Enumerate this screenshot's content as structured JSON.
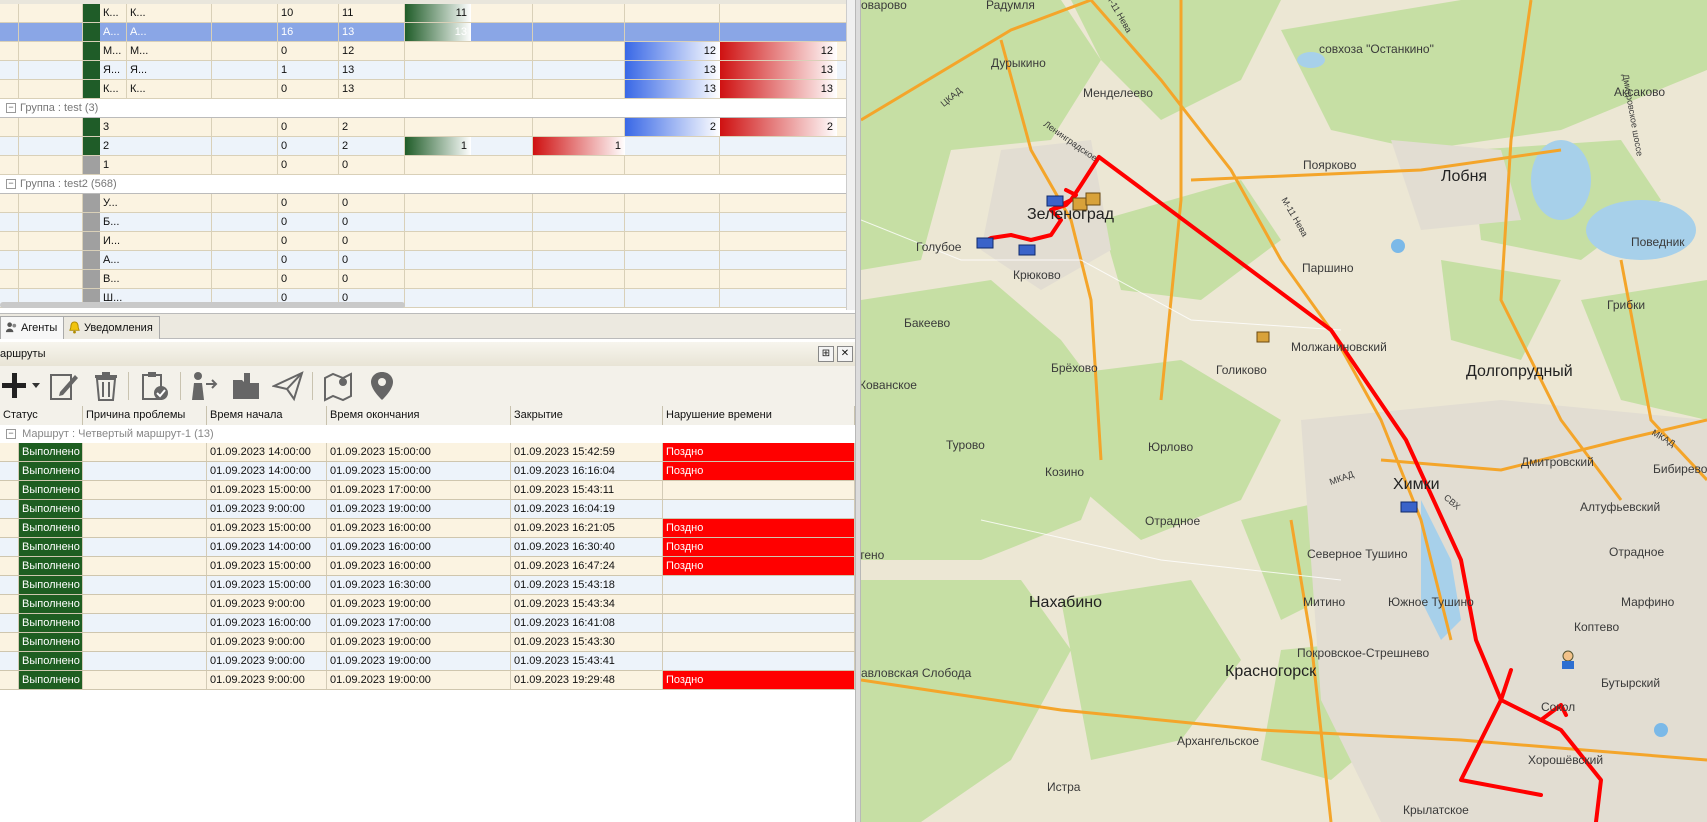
{
  "agents": {
    "rows": [
      {
        "name": "К...",
        "name2": "К...",
        "v1": "10",
        "v2": "11",
        "bar_green": "11",
        "swatch": "#1f5c28",
        "state": "even"
      },
      {
        "name": "А...",
        "name2": "А...",
        "v1": "16",
        "v2": "13",
        "bar_green": "13",
        "swatch": "#1f5c28",
        "state": "sel"
      },
      {
        "name": "М...",
        "name2": "М...",
        "v1": "0",
        "v2": "12",
        "bar_blue": "12",
        "bar_red": "12",
        "swatch": "#1f5c28",
        "state": "even"
      },
      {
        "name": "Я...",
        "name2": "Я...",
        "v1": "1",
        "v2": "13",
        "bar_blue": "13",
        "bar_red": "13",
        "swatch": "#1f5c28",
        "state": "odd"
      },
      {
        "name": "К...",
        "name2": "К...",
        "v1": "0",
        "v2": "13",
        "bar_blue": "13",
        "bar_red": "13",
        "swatch": "#1f5c28",
        "state": "even"
      }
    ],
    "group_test": {
      "label": "Группа : test (3)",
      "rows": [
        {
          "name": "3",
          "v1": "0",
          "v2": "2",
          "bar_blue": "2",
          "bar_red": "2",
          "swatch": "#1f5c28",
          "state": "even"
        },
        {
          "name": "2",
          "v1": "0",
          "v2": "2",
          "bar_green": "1",
          "bar_red2": "1",
          "swatch": "#1f5c28",
          "state": "odd"
        },
        {
          "name": "1",
          "v1": "0",
          "v2": "0",
          "swatch": "#a0a0a0",
          "state": "even"
        }
      ]
    },
    "group_test2": {
      "label": "Группа : test2 (568)",
      "rows": [
        {
          "name": "У...",
          "v1": "0",
          "v2": "0",
          "state": "even"
        },
        {
          "name": "Б...",
          "v1": "0",
          "v2": "0",
          "state": "odd"
        },
        {
          "name": "И...",
          "v1": "0",
          "v2": "0",
          "state": "even"
        },
        {
          "name": "А...",
          "v1": "0",
          "v2": "0",
          "state": "odd"
        },
        {
          "name": "В...",
          "v1": "0",
          "v2": "0",
          "state": "even"
        },
        {
          "name": "Ш...",
          "v1": "0",
          "v2": "0",
          "state": "odd"
        }
      ]
    }
  },
  "tabs": {
    "agents": "Агенты",
    "notifications": "Уведомления"
  },
  "routes": {
    "title": "аршруты",
    "pin_btn": "⊞",
    "close_btn": "✕",
    "columns": [
      "Статус",
      "Причина проблемы",
      "Время начала",
      "Время окончания",
      "Закрытие",
      "Нарушение времени"
    ],
    "group_label": "Маршрут : Четвертый маршрут-1 (13)",
    "rows": [
      {
        "status": "Выполнено",
        "start": "01.09.2023 14:00:00",
        "end": "01.09.2023 15:00:00",
        "close": "01.09.2023 15:42:59",
        "late": "Поздно"
      },
      {
        "status": "Выполнено",
        "start": "01.09.2023 14:00:00",
        "end": "01.09.2023 15:00:00",
        "close": "01.09.2023 16:16:04",
        "late": "Поздно"
      },
      {
        "status": "Выполнено",
        "start": "01.09.2023 15:00:00",
        "end": "01.09.2023 17:00:00",
        "close": "01.09.2023 15:43:11",
        "late": ""
      },
      {
        "status": "Выполнено",
        "start": "01.09.2023 9:00:00",
        "end": "01.09.2023 19:00:00",
        "close": "01.09.2023 16:04:19",
        "late": ""
      },
      {
        "status": "Выполнено",
        "start": "01.09.2023 15:00:00",
        "end": "01.09.2023 16:00:00",
        "close": "01.09.2023 16:21:05",
        "late": "Поздно"
      },
      {
        "status": "Выполнено",
        "start": "01.09.2023 14:00:00",
        "end": "01.09.2023 16:00:00",
        "close": "01.09.2023 16:30:40",
        "late": "Поздно"
      },
      {
        "status": "Выполнено",
        "start": "01.09.2023 15:00:00",
        "end": "01.09.2023 16:00:00",
        "close": "01.09.2023 16:47:24",
        "late": "Поздно"
      },
      {
        "status": "Выполнено",
        "start": "01.09.2023 15:00:00",
        "end": "01.09.2023 16:30:00",
        "close": "01.09.2023 15:43:18",
        "late": ""
      },
      {
        "status": "Выполнено",
        "start": "01.09.2023 9:00:00",
        "end": "01.09.2023 19:00:00",
        "close": "01.09.2023 15:43:34",
        "late": ""
      },
      {
        "status": "Выполнено",
        "start": "01.09.2023 16:00:00",
        "end": "01.09.2023 17:00:00",
        "close": "01.09.2023 16:41:08",
        "late": ""
      },
      {
        "status": "Выполнено",
        "start": "01.09.2023 9:00:00",
        "end": "01.09.2023 19:00:00",
        "close": "01.09.2023 15:43:30",
        "late": ""
      },
      {
        "status": "Выполнено",
        "start": "01.09.2023 9:00:00",
        "end": "01.09.2023 19:00:00",
        "close": "01.09.2023 15:43:41",
        "late": ""
      },
      {
        "status": "Выполнено",
        "start": "01.09.2023 9:00:00",
        "end": "01.09.2023 19:00:00",
        "close": "01.09.2023 19:29:48",
        "late": "Поздно"
      }
    ]
  },
  "map": {
    "labels": [
      {
        "text": "оварово",
        "cls": "s"
      },
      {
        "text": "Радумля",
        "cls": "s"
      },
      {
        "text": "совхоза \"Останкино\"",
        "cls": "s"
      },
      {
        "text": "Дурыкино",
        "cls": "s"
      },
      {
        "text": "Менделеево",
        "cls": "s"
      },
      {
        "text": "Аксаково",
        "cls": "s"
      },
      {
        "text": "Поярково",
        "cls": "s"
      },
      {
        "text": "Лобня",
        "cls": "l"
      },
      {
        "text": "Зеленоград",
        "cls": "l"
      },
      {
        "text": "Голубое",
        "cls": "s"
      },
      {
        "text": "Крюково",
        "cls": "s"
      },
      {
        "text": "Паршино",
        "cls": "s"
      },
      {
        "text": "Поведник",
        "cls": "s"
      },
      {
        "text": "Грибки",
        "cls": "s"
      },
      {
        "text": "Бакеево",
        "cls": "s"
      },
      {
        "text": "Молжаниновский",
        "cls": "s"
      },
      {
        "text": "Долгопрудный",
        "cls": "l"
      },
      {
        "text": "Кованское",
        "cls": "s"
      },
      {
        "text": "Брёхово",
        "cls": "s"
      },
      {
        "text": "Голиково",
        "cls": "s"
      },
      {
        "text": "Турово",
        "cls": "s"
      },
      {
        "text": "Юрлово",
        "cls": "s"
      },
      {
        "text": "Дмитровский",
        "cls": "s"
      },
      {
        "text": "Бибирево",
        "cls": "s"
      },
      {
        "text": "Козино",
        "cls": "s"
      },
      {
        "text": "Химки",
        "cls": "l"
      },
      {
        "text": "Алтуфьевский",
        "cls": "s"
      },
      {
        "text": "Отрадное",
        "cls": "s"
      },
      {
        "text": "Отрадное",
        "cls": "s"
      },
      {
        "text": "тено",
        "cls": "s"
      },
      {
        "text": "Северное Тушино",
        "cls": "s"
      },
      {
        "text": "Нахабино",
        "cls": "l"
      },
      {
        "text": "Митино",
        "cls": "s"
      },
      {
        "text": "Южное Тушино",
        "cls": "s"
      },
      {
        "text": "Марфино",
        "cls": "s"
      },
      {
        "text": "Коптево",
        "cls": "s"
      },
      {
        "text": "Покровское-Стрешнево",
        "cls": "s"
      },
      {
        "text": "авловская Слобода",
        "cls": "s"
      },
      {
        "text": "Красногорск",
        "cls": "l"
      },
      {
        "text": "Бутырский",
        "cls": "s"
      },
      {
        "text": "Сокол",
        "cls": "s"
      },
      {
        "text": "Архангельское",
        "cls": "s"
      },
      {
        "text": "Хорошёвский",
        "cls": "s"
      },
      {
        "text": "Истра",
        "cls": "s"
      },
      {
        "text": "Крылатское",
        "cls": "s"
      }
    ],
    "road_labels": [
      "ЦКАД",
      "Ленинградское",
      "М-11 Нева",
      "М-11 Нева",
      "МКАД",
      "СВХ",
      "МКАД",
      "Дмитровское шоссе"
    ],
    "colors": {
      "route": "#ff0000",
      "forest": "#c8e2a8",
      "road": "#f4a52a"
    }
  }
}
